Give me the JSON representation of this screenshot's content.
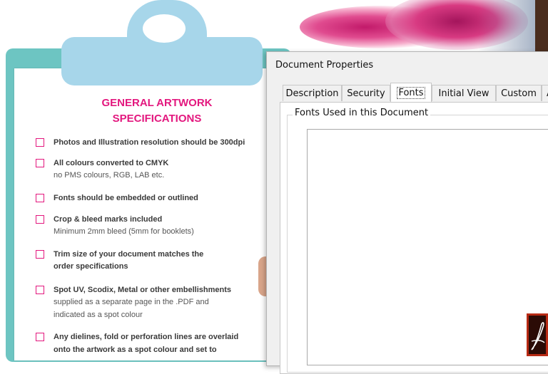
{
  "dialog": {
    "title": "Document Properties",
    "tabs": [
      {
        "label": "Description"
      },
      {
        "label": "Security"
      },
      {
        "label": "Fonts",
        "active": true
      },
      {
        "label": "Initial View"
      },
      {
        "label": "Custom"
      },
      {
        "label": "A"
      }
    ],
    "fonts_group_label": "Fonts Used in this Document"
  },
  "background": {
    "spec_sheet": {
      "title_line1": "GENERAL ARTWORK",
      "title_line2": "SPECIFICATIONS",
      "items": [
        {
          "main": "Photos and Illustration resolution should be 300dpi",
          "sub": []
        },
        {
          "main": "All colours converted to CMYK",
          "sub": [
            "no PMS colours, RGB, LAB etc."
          ]
        },
        {
          "main": "Fonts should be embedded or outlined",
          "sub": []
        },
        {
          "main": "Crop & bleed marks included",
          "sub": [
            "Minimum 2mm bleed (5mm for booklets)"
          ]
        },
        {
          "main": "Trim size of your document matches the",
          "sub": [
            "order specifications"
          ]
        },
        {
          "main": "Spot UV, Scodix, Metal or other embellishments",
          "sub": [
            "supplied as a separate page in the .PDF and",
            "indicated as a spot colour"
          ]
        },
        {
          "main": "Any dielines, fold or perforation lines are overlaid",
          "sub": [
            "onto the artwork as a spot colour and set to"
          ]
        }
      ]
    },
    "colors": {
      "accent": "#e3177e",
      "clipboard": "#6dc5c2",
      "clip": "#a7d6ea"
    },
    "taskbar_icon": "acrobat-icon"
  }
}
